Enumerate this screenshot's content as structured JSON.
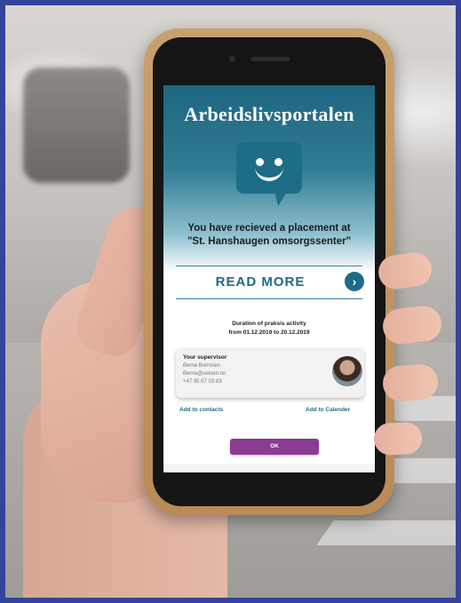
{
  "app": {
    "title": "Arbeidslivsportalen",
    "notification": {
      "line1": "You have recieved a placement at",
      "line2": "\"St. Hanshaugen omsorgssenter\""
    },
    "read_more_label": "READ MORE",
    "duration": {
      "line1": "Duration of praksis activity",
      "line2": "from 01.12.2019 to 20.12.2019"
    },
    "supervisor": {
      "title": "Your supervisor",
      "name": "Berna Borrosen",
      "email": "Berna@uelsen.no",
      "phone": "+47 95 07 03 83"
    },
    "add_contacts_label": "Add to contacts",
    "add_calendar_label": "Add to Calender",
    "ok_label": "OK"
  },
  "icons": {
    "chat": "chat-smiley-icon",
    "read_more": "chevron-right-icon"
  },
  "colors": {
    "brand_teal": "#1f6a85",
    "button_purple": "#8a3c92",
    "frame_border": "#34449a"
  }
}
